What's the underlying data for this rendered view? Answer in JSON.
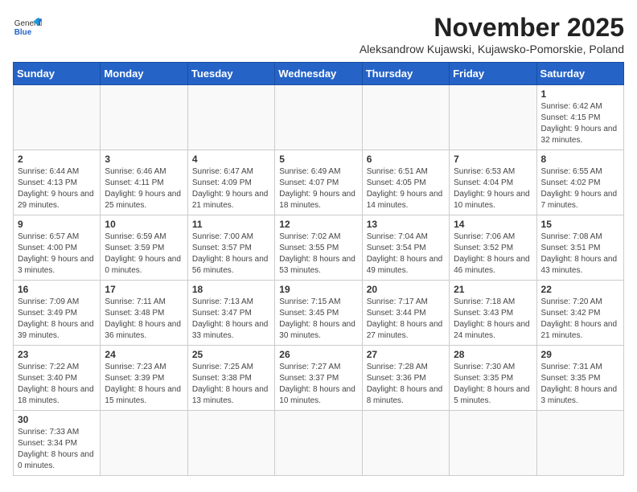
{
  "header": {
    "logo_general": "General",
    "logo_blue": "Blue",
    "month_title": "November 2025",
    "location": "Aleksandrow Kujawski, Kujawsko-Pomorskie, Poland"
  },
  "weekdays": [
    "Sunday",
    "Monday",
    "Tuesday",
    "Wednesday",
    "Thursday",
    "Friday",
    "Saturday"
  ],
  "weeks": [
    [
      {
        "day": "",
        "info": ""
      },
      {
        "day": "",
        "info": ""
      },
      {
        "day": "",
        "info": ""
      },
      {
        "day": "",
        "info": ""
      },
      {
        "day": "",
        "info": ""
      },
      {
        "day": "",
        "info": ""
      },
      {
        "day": "1",
        "info": "Sunrise: 6:42 AM\nSunset: 4:15 PM\nDaylight: 9 hours\nand 32 minutes."
      }
    ],
    [
      {
        "day": "2",
        "info": "Sunrise: 6:44 AM\nSunset: 4:13 PM\nDaylight: 9 hours\nand 29 minutes."
      },
      {
        "day": "3",
        "info": "Sunrise: 6:46 AM\nSunset: 4:11 PM\nDaylight: 9 hours\nand 25 minutes."
      },
      {
        "day": "4",
        "info": "Sunrise: 6:47 AM\nSunset: 4:09 PM\nDaylight: 9 hours\nand 21 minutes."
      },
      {
        "day": "5",
        "info": "Sunrise: 6:49 AM\nSunset: 4:07 PM\nDaylight: 9 hours\nand 18 minutes."
      },
      {
        "day": "6",
        "info": "Sunrise: 6:51 AM\nSunset: 4:05 PM\nDaylight: 9 hours\nand 14 minutes."
      },
      {
        "day": "7",
        "info": "Sunrise: 6:53 AM\nSunset: 4:04 PM\nDaylight: 9 hours\nand 10 minutes."
      },
      {
        "day": "8",
        "info": "Sunrise: 6:55 AM\nSunset: 4:02 PM\nDaylight: 9 hours\nand 7 minutes."
      }
    ],
    [
      {
        "day": "9",
        "info": "Sunrise: 6:57 AM\nSunset: 4:00 PM\nDaylight: 9 hours\nand 3 minutes."
      },
      {
        "day": "10",
        "info": "Sunrise: 6:59 AM\nSunset: 3:59 PM\nDaylight: 9 hours\nand 0 minutes."
      },
      {
        "day": "11",
        "info": "Sunrise: 7:00 AM\nSunset: 3:57 PM\nDaylight: 8 hours\nand 56 minutes."
      },
      {
        "day": "12",
        "info": "Sunrise: 7:02 AM\nSunset: 3:55 PM\nDaylight: 8 hours\nand 53 minutes."
      },
      {
        "day": "13",
        "info": "Sunrise: 7:04 AM\nSunset: 3:54 PM\nDaylight: 8 hours\nand 49 minutes."
      },
      {
        "day": "14",
        "info": "Sunrise: 7:06 AM\nSunset: 3:52 PM\nDaylight: 8 hours\nand 46 minutes."
      },
      {
        "day": "15",
        "info": "Sunrise: 7:08 AM\nSunset: 3:51 PM\nDaylight: 8 hours\nand 43 minutes."
      }
    ],
    [
      {
        "day": "16",
        "info": "Sunrise: 7:09 AM\nSunset: 3:49 PM\nDaylight: 8 hours\nand 39 minutes."
      },
      {
        "day": "17",
        "info": "Sunrise: 7:11 AM\nSunset: 3:48 PM\nDaylight: 8 hours\nand 36 minutes."
      },
      {
        "day": "18",
        "info": "Sunrise: 7:13 AM\nSunset: 3:47 PM\nDaylight: 8 hours\nand 33 minutes."
      },
      {
        "day": "19",
        "info": "Sunrise: 7:15 AM\nSunset: 3:45 PM\nDaylight: 8 hours\nand 30 minutes."
      },
      {
        "day": "20",
        "info": "Sunrise: 7:17 AM\nSunset: 3:44 PM\nDaylight: 8 hours\nand 27 minutes."
      },
      {
        "day": "21",
        "info": "Sunrise: 7:18 AM\nSunset: 3:43 PM\nDaylight: 8 hours\nand 24 minutes."
      },
      {
        "day": "22",
        "info": "Sunrise: 7:20 AM\nSunset: 3:42 PM\nDaylight: 8 hours\nand 21 minutes."
      }
    ],
    [
      {
        "day": "23",
        "info": "Sunrise: 7:22 AM\nSunset: 3:40 PM\nDaylight: 8 hours\nand 18 minutes."
      },
      {
        "day": "24",
        "info": "Sunrise: 7:23 AM\nSunset: 3:39 PM\nDaylight: 8 hours\nand 15 minutes."
      },
      {
        "day": "25",
        "info": "Sunrise: 7:25 AM\nSunset: 3:38 PM\nDaylight: 8 hours\nand 13 minutes."
      },
      {
        "day": "26",
        "info": "Sunrise: 7:27 AM\nSunset: 3:37 PM\nDaylight: 8 hours\nand 10 minutes."
      },
      {
        "day": "27",
        "info": "Sunrise: 7:28 AM\nSunset: 3:36 PM\nDaylight: 8 hours\nand 8 minutes."
      },
      {
        "day": "28",
        "info": "Sunrise: 7:30 AM\nSunset: 3:35 PM\nDaylight: 8 hours\nand 5 minutes."
      },
      {
        "day": "29",
        "info": "Sunrise: 7:31 AM\nSunset: 3:35 PM\nDaylight: 8 hours\nand 3 minutes."
      }
    ],
    [
      {
        "day": "30",
        "info": "Sunrise: 7:33 AM\nSunset: 3:34 PM\nDaylight: 8 hours\nand 0 minutes."
      },
      {
        "day": "",
        "info": ""
      },
      {
        "day": "",
        "info": ""
      },
      {
        "day": "",
        "info": ""
      },
      {
        "day": "",
        "info": ""
      },
      {
        "day": "",
        "info": ""
      },
      {
        "day": "",
        "info": ""
      }
    ]
  ]
}
